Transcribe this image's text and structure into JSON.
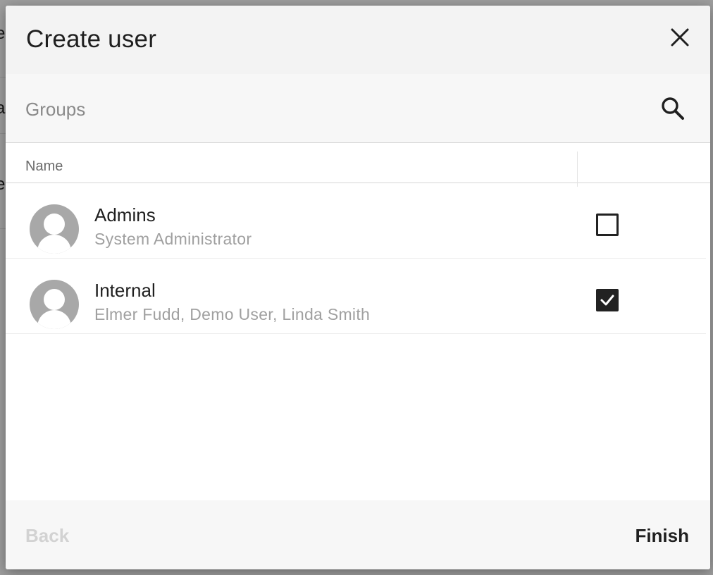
{
  "dialog": {
    "title": "Create user"
  },
  "search": {
    "placeholder": "Groups"
  },
  "table": {
    "columns": [
      "Name"
    ]
  },
  "groups": [
    {
      "name": "Admins",
      "members": "System Administrator",
      "checked": false
    },
    {
      "name": "Internal",
      "members": "Elmer Fudd, Demo User, Linda Smith",
      "checked": true
    }
  ],
  "footer": {
    "back_label": "Back",
    "finish_label": "Finish"
  },
  "icons": {
    "close": "close-icon",
    "search": "search-icon",
    "avatar": "user-avatar-icon",
    "checkmark": "checkmark-icon"
  },
  "colors": {
    "header_bg": "#f3f3f3",
    "text_primary": "#1f1f1f",
    "text_secondary": "#a0a0a0",
    "disabled": "#d2d2d2",
    "checkbox": "#222222"
  }
}
